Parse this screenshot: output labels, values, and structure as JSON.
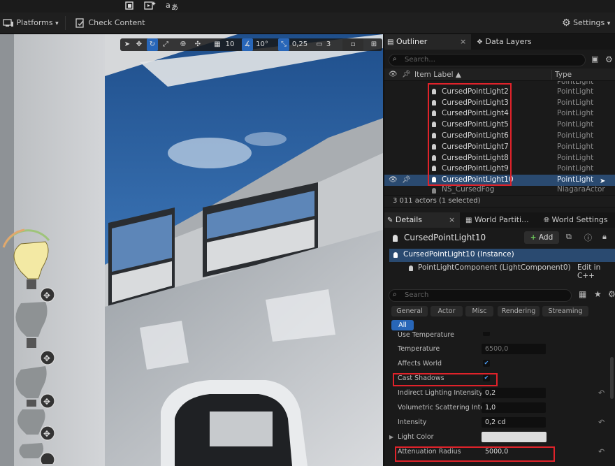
{
  "top_icons": [
    "layout-icon",
    "play-sparkle-icon",
    "translate-icon"
  ],
  "toolbar": {
    "platforms": "Platforms",
    "check_content": "Check Content",
    "settings": "Settings"
  },
  "viewport_toolbar": {
    "grid_snap": "10",
    "rot_snap": "10°",
    "scale_snap": "0,25",
    "camera_speed": "3"
  },
  "outliner": {
    "tab_label": "Outliner",
    "data_layers_label": "Data Layers",
    "search_placeholder": "Search...",
    "col_label": "Item Label ▲",
    "col_type": "Type",
    "rows": [
      {
        "label": "CursedPointLight2",
        "type": "PointLight"
      },
      {
        "label": "CursedPointLight3",
        "type": "PointLight"
      },
      {
        "label": "CursedPointLight4",
        "type": "PointLight"
      },
      {
        "label": "CursedPointLight5",
        "type": "PointLight"
      },
      {
        "label": "CursedPointLight6",
        "type": "PointLight"
      },
      {
        "label": "CursedPointLight7",
        "type": "PointLight"
      },
      {
        "label": "CursedPointLight8",
        "type": "PointLight"
      },
      {
        "label": "CursedPointLight9",
        "type": "PointLight"
      },
      {
        "label": "CursedPointLight10",
        "type": "PointLight"
      },
      {
        "label": "NS_CursedFog",
        "type": "NiagaraActor"
      }
    ],
    "status": "3 011 actors (1 selected)"
  },
  "details": {
    "tab_label": "Details",
    "world_partition_label": "World Partiti...",
    "world_settings_label": "World Settings",
    "actor_name": "CursedPointLight10",
    "add_label": "Add",
    "instance_label": "CursedPointLight10 (Instance)",
    "component_label": "PointLightComponent (LightComponent0)",
    "edit_cpp": "Edit in C++",
    "search_placeholder": "Search",
    "categories": [
      "General",
      "Actor",
      "Misc",
      "Rendering",
      "Streaming",
      "All"
    ],
    "props": {
      "use_temperature": "Use Temperature",
      "temperature": "Temperature",
      "temperature_val": "6500,0",
      "affects_world": "Affects World",
      "cast_shadows": "Cast Shadows",
      "indirect": "Indirect Lighting Intensity",
      "indirect_val": "0,2",
      "volumetric": "Volumetric Scattering Inten...",
      "volumetric_val": "1,0",
      "intensity": "Intensity",
      "intensity_val": "0,2 cd",
      "light_color": "Light Color",
      "attenuation": "Attenuation Radius",
      "attenuation_val": "5000,0"
    }
  }
}
